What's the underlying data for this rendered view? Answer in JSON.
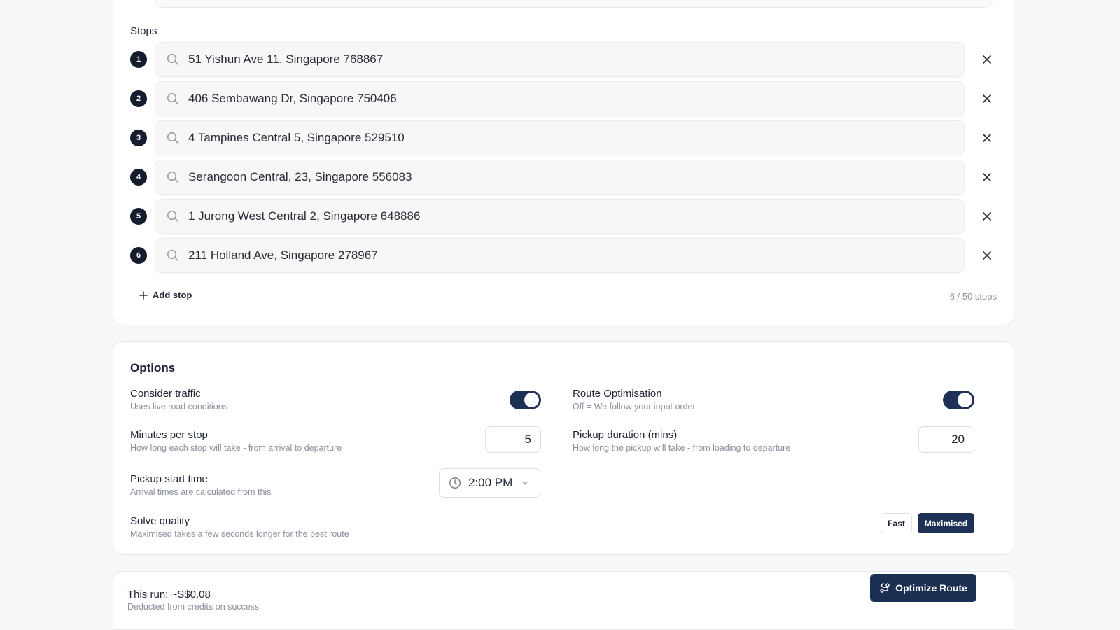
{
  "stops": {
    "label": "Stops",
    "items": [
      {
        "number": "1",
        "address": "51 Yishun Ave 11, Singapore 768867"
      },
      {
        "number": "2",
        "address": "406 Sembawang Dr, Singapore 750406"
      },
      {
        "number": "3",
        "address": "4 Tampines Central 5, Singapore 529510"
      },
      {
        "number": "4",
        "address": "Serangoon Central, 23, Singapore 556083"
      },
      {
        "number": "5",
        "address": "1 Jurong West Central 2, Singapore 648886"
      },
      {
        "number": "6",
        "address": "211 Holland Ave, Singapore 278967"
      }
    ],
    "add_label": "Add stop",
    "count": "6 / 50 stops"
  },
  "options": {
    "title": "Options",
    "consider_traffic": {
      "label": "Consider traffic",
      "hint": "Uses live road conditions",
      "enabled": true
    },
    "route_optimisation": {
      "label": "Route Optimisation",
      "hint": "Off = We follow your input order",
      "enabled": true
    },
    "minutes_per_stop": {
      "label": "Minutes per stop",
      "hint": "How long each stop will take - from arrival to departure",
      "value": "5"
    },
    "pickup_duration": {
      "label": "Pickup duration (mins)",
      "hint": "How long the pickup will take - from loading to departure",
      "value": "20"
    },
    "pickup_start": {
      "label": "Pickup start time",
      "hint": "Arrival times are calculated from this",
      "value": "2:00 PM"
    },
    "solve_quality": {
      "label": "Solve quality",
      "hint": "Maximised takes a few seconds longer for the best route",
      "options": [
        "Fast",
        "Maximised"
      ],
      "selected": "Maximised"
    }
  },
  "footer": {
    "run_cost": "This run: ~S$0.08",
    "run_hint": "Deducted from credits on success",
    "optimize_label": "Optimize Route"
  },
  "colors": {
    "accent": "#1d3055",
    "badge": "#141c2e",
    "muted": "#8a909c"
  }
}
